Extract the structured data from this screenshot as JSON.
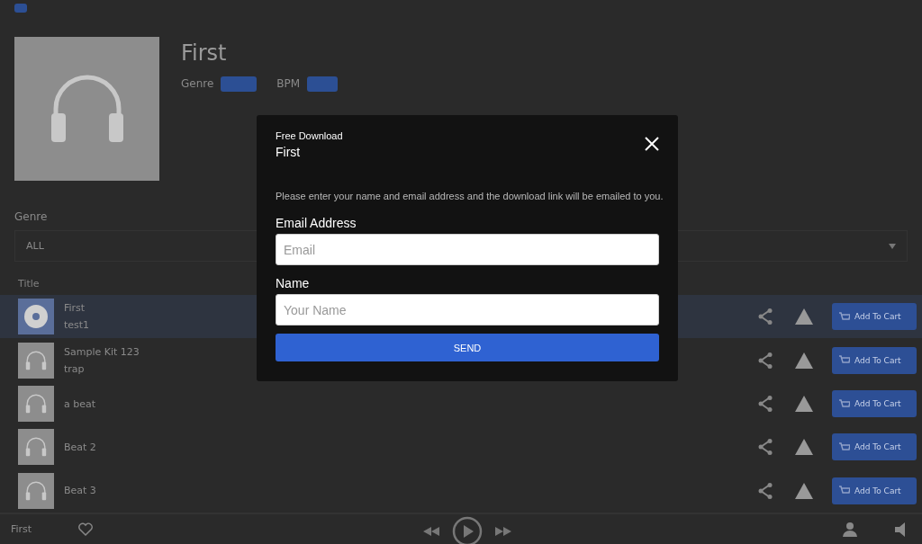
{
  "track": {
    "title": "First",
    "genre_label": "Genre",
    "bpm_label": "BPM"
  },
  "filter": {
    "label": "Genre",
    "value": "ALL"
  },
  "list": {
    "column": "Title",
    "rows": [
      {
        "title": "First",
        "subtitle": "test1",
        "selected": true,
        "button": "Add To Cart"
      },
      {
        "title": "Sample Kit 123",
        "subtitle": "trap",
        "selected": false,
        "button": "Add To Cart"
      },
      {
        "title": "a beat",
        "selected": false,
        "button": "Add To Cart"
      },
      {
        "title": "Beat 2",
        "selected": false,
        "button": "Add To Cart"
      },
      {
        "title": "Beat 3",
        "selected": false,
        "button": "Add To Cart"
      }
    ]
  },
  "player": {
    "title": "First"
  },
  "dialog": {
    "kicker": "Free Download",
    "title": "First",
    "message": "Please enter your name and email address and the download link will be emailed to you.",
    "fields": [
      {
        "label": "Email Address",
        "placeholder": "Email"
      },
      {
        "label": "Name",
        "placeholder": "Your Name"
      }
    ],
    "button": "SEND"
  }
}
